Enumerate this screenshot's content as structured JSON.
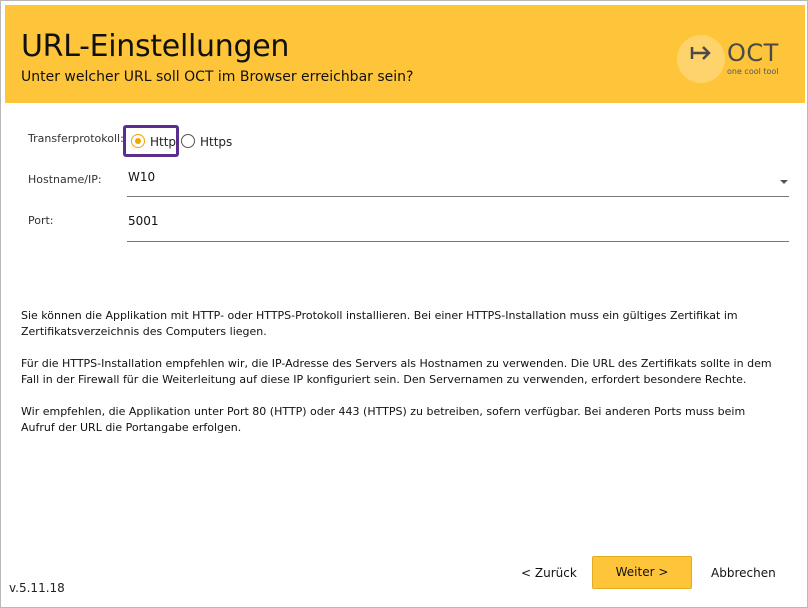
{
  "header": {
    "title": "URL-Einstellungen",
    "subtitle": "Unter welcher URL soll OCT im Browser erreichbar sein?",
    "logo": {
      "name": "OCT",
      "tagline": "one cool tool",
      "icon": "arrow-right-icon"
    },
    "background": "#fec53a"
  },
  "form": {
    "protocol_label": "Transferprotokoll:",
    "protocol_options": [
      {
        "label": "Http",
        "checked": true
      },
      {
        "label": "Https",
        "checked": false
      }
    ],
    "hostname_label": "Hostname/IP:",
    "hostname_value": "W10",
    "port_label": "Port:",
    "port_value": "5001"
  },
  "info": [
    "Sie können die Applikation mit HTTP- oder HTTPS-Protokoll installieren. Bei einer HTTPS-Installation muss ein gültiges Zertifikat im Zertifikatsverzeichnis des Computers liegen.",
    "Für die HTTPS-Installation empfehlen wir, die IP-Adresse des Servers als Hostnamen zu verwenden. Die URL des Zertifikats sollte in dem Fall in der Firewall für die Weiterleitung auf diese IP konfiguriert sein. Den Servernamen zu verwenden, erfordert besondere Rechte.",
    "Wir empfehlen, die Applikation unter Port 80 (HTTP) oder 443 (HTTPS) zu betreiben, sofern verfügbar. Bei anderen Ports muss beim Aufruf der URL die Portangabe erfolgen."
  ],
  "footer": {
    "version": "v.5.11.18",
    "back_label": "< Zurück",
    "next_label": "Weiter >",
    "cancel_label": "Abbrechen"
  },
  "colors": {
    "accent": "#fec53a",
    "highlight": "#5c2d91",
    "radio": "#f0a500"
  }
}
